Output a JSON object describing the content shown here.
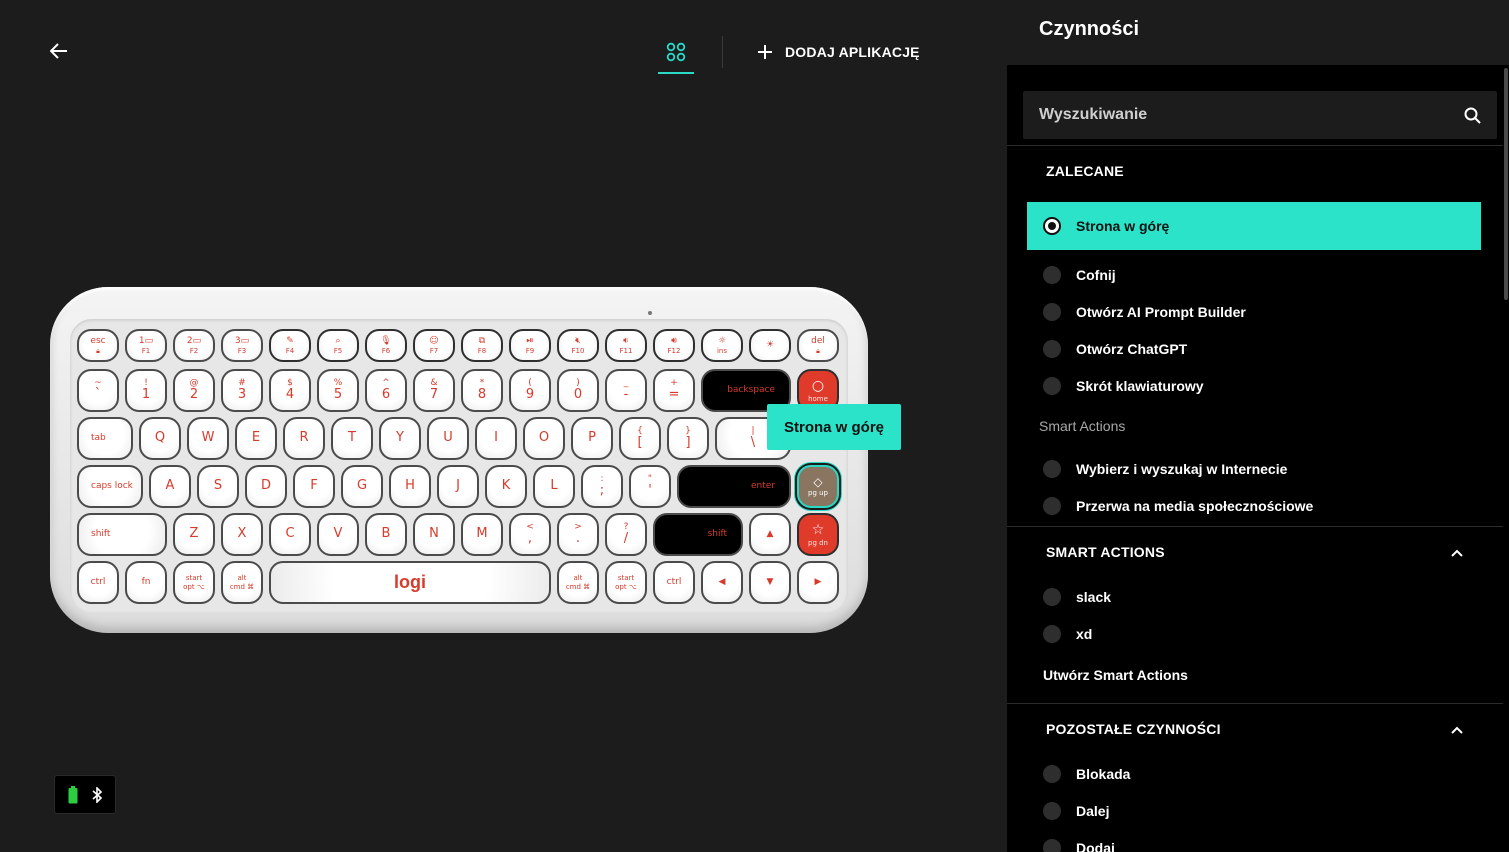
{
  "nav": {
    "add_app_label": "DODAJ APLIKACJĘ"
  },
  "keyboard": {
    "brand": "logi",
    "keys": {
      "esc": "esc",
      "f1": "F1",
      "f2": "F2",
      "f3": "F3",
      "f4": "F4",
      "f5": "F5",
      "f6": "F6",
      "f7": "F7",
      "f8": "F8",
      "f9": "F9",
      "f10": "F10",
      "f11": "F11",
      "f12": "F12",
      "ins": "ins",
      "del": "del",
      "n1": "1",
      "n2": "2",
      "n3": "3",
      "tilde": "~",
      "backtick": "`",
      "excl": "!",
      "one": "1",
      "at": "@",
      "two": "2",
      "hash": "#",
      "three": "3",
      "dollar": "$",
      "four": "4",
      "pct": "%",
      "five": "5",
      "caret": "^",
      "six": "6",
      "amp": "&",
      "seven": "7",
      "star": "*",
      "eight": "8",
      "lparen": "(",
      "nine": "9",
      "rparen": ")",
      "zero": "0",
      "under": "_",
      "minus": "-",
      "plus": "+",
      "equals": "=",
      "backspace": "backspace",
      "home": "home",
      "tab": "tab",
      "q": "Q",
      "w": "W",
      "e": "E",
      "r": "R",
      "t": "T",
      "y": "Y",
      "u": "U",
      "i": "I",
      "o": "O",
      "p": "P",
      "lbrace": "{",
      "lbracket": "[",
      "rbrace": "}",
      "rbracket": "]",
      "pipe": "|",
      "bslash": "\\",
      "caps": "caps lock",
      "a": "A",
      "s": "S",
      "d": "D",
      "f": "F",
      "g": "G",
      "h": "H",
      "j": "J",
      "k": "K",
      "l": "L",
      "colon": ":",
      "semicolon": ";",
      "dquote": "\"",
      "squote": "'",
      "enter": "enter",
      "pgup": "pg up",
      "shift": "shift",
      "z": "Z",
      "x": "X",
      "c": "C",
      "v": "V",
      "b": "B",
      "n": "N",
      "m": "M",
      "lt": "<",
      "comma": ",",
      "gt": ">",
      "period": ".",
      "qmark": "?",
      "slash": "/",
      "shift_r": "shift",
      "pgdn": "pg dn",
      "ctrl": "ctrl",
      "fn": "fn",
      "start": "start",
      "opt": "opt ⌥",
      "alt": "alt",
      "cmd": "cmd ⌘",
      "ctrl_r": "ctrl"
    }
  },
  "tooltip": "Strona w górę",
  "panel": {
    "title": "Czynności",
    "search_placeholder": "Wyszukiwanie",
    "recommended": {
      "title": "ZALECANE",
      "items": [
        "Strona w górę",
        "Cofnij",
        "Otwórz AI Prompt Builder",
        "Otwórz ChatGPT",
        "Skrót klawiaturowy"
      ],
      "subhead": "Smart Actions",
      "smart_items": [
        "Wybierz i wyszukaj w Internecie",
        "Przerwa na media społecznościowe"
      ]
    },
    "smart_actions": {
      "title": "SMART ACTIONS",
      "items": [
        "slack",
        "xd"
      ],
      "create_link": "Utwórz Smart Actions"
    },
    "other": {
      "title": "POZOSTAŁE CZYNNOŚCI",
      "items": [
        "Blokada",
        "Dalej",
        "Dodaj"
      ]
    }
  },
  "colors": {
    "accent": "#2ae3c9",
    "key_red": "#e03a2a",
    "legend_red": "#d63b2b"
  }
}
